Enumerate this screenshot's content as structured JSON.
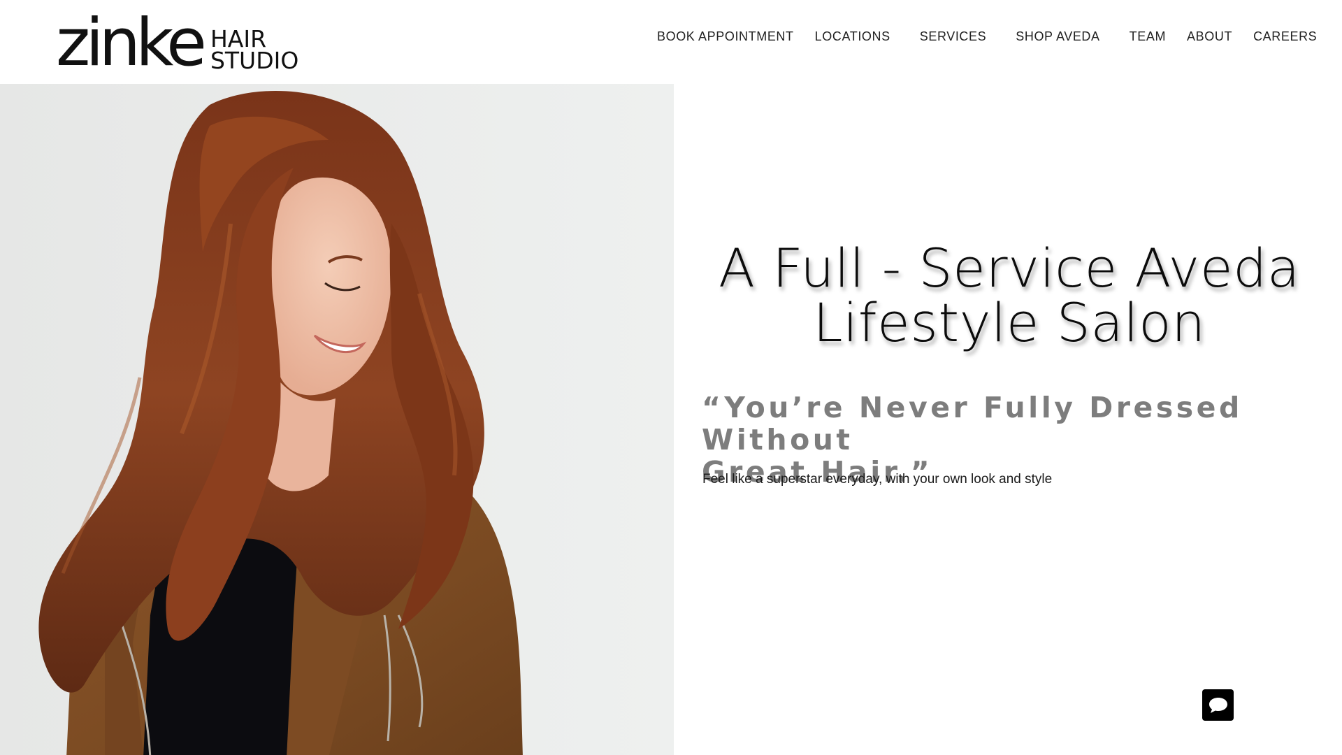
{
  "brand": {
    "word": "zinke",
    "line1": "HAIR",
    "line2": "STUDIO"
  },
  "nav": {
    "items": [
      {
        "label": "BOOK APPOINTMENT"
      },
      {
        "label": "LOCATIONS"
      },
      {
        "label": "SERVICES"
      },
      {
        "label": "SHOP AVEDA"
      },
      {
        "label": "TEAM"
      },
      {
        "label": "ABOUT"
      },
      {
        "label": "CAREERS"
      }
    ]
  },
  "hero": {
    "image_subject": "woman-with-long-red-hair-in-brown-suede-jacket",
    "headline_line1": "A Full - Service Aveda",
    "headline_line2": "Lifestyle Salon",
    "quote_line1": "“You’re Never Fully Dressed Without",
    "quote_line2": "Great Hair.”",
    "subtext": "Feel like a superstar everyday, with your own look and style"
  },
  "chat": {
    "icon": "chat-bubble-icon"
  },
  "colors": {
    "quote": "#7d7d7d",
    "photo_background": "#e9eaea",
    "chat_button": "#000000"
  }
}
